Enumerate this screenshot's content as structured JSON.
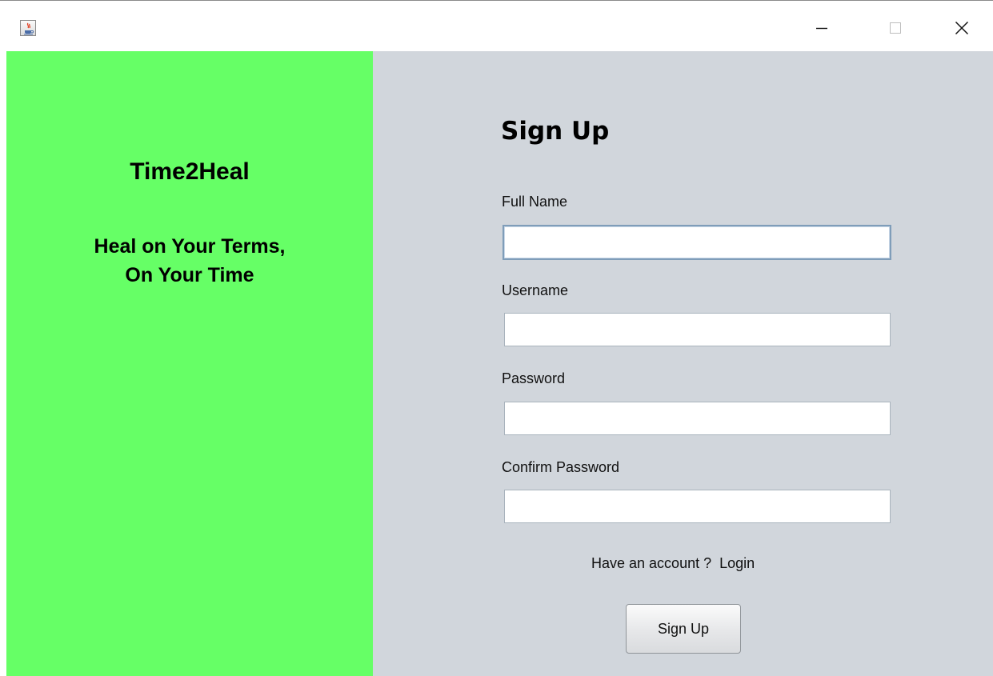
{
  "window": {
    "app_icon": "java-cup-icon",
    "controls": {
      "minimize_icon": "minimize-icon",
      "maximize_icon": "maximize-icon",
      "close_icon": "close-icon"
    }
  },
  "brand_panel": {
    "app_name": "Time2Heal",
    "tagline_line1": "Heal on Your Terms,",
    "tagline_line2": "On Your Time",
    "background_color": "#66ff66"
  },
  "signup_form": {
    "title": "Sign Up",
    "background_color": "#d1d6dc",
    "fields": {
      "full_name": {
        "label": "Full Name",
        "value": ""
      },
      "username": {
        "label": "Username",
        "value": ""
      },
      "password": {
        "label": "Password",
        "value": ""
      },
      "confirm_password": {
        "label": "Confirm Password",
        "value": ""
      }
    },
    "account_prompt": "Have an account ?",
    "login_link": "Login",
    "submit_label": "Sign Up"
  }
}
